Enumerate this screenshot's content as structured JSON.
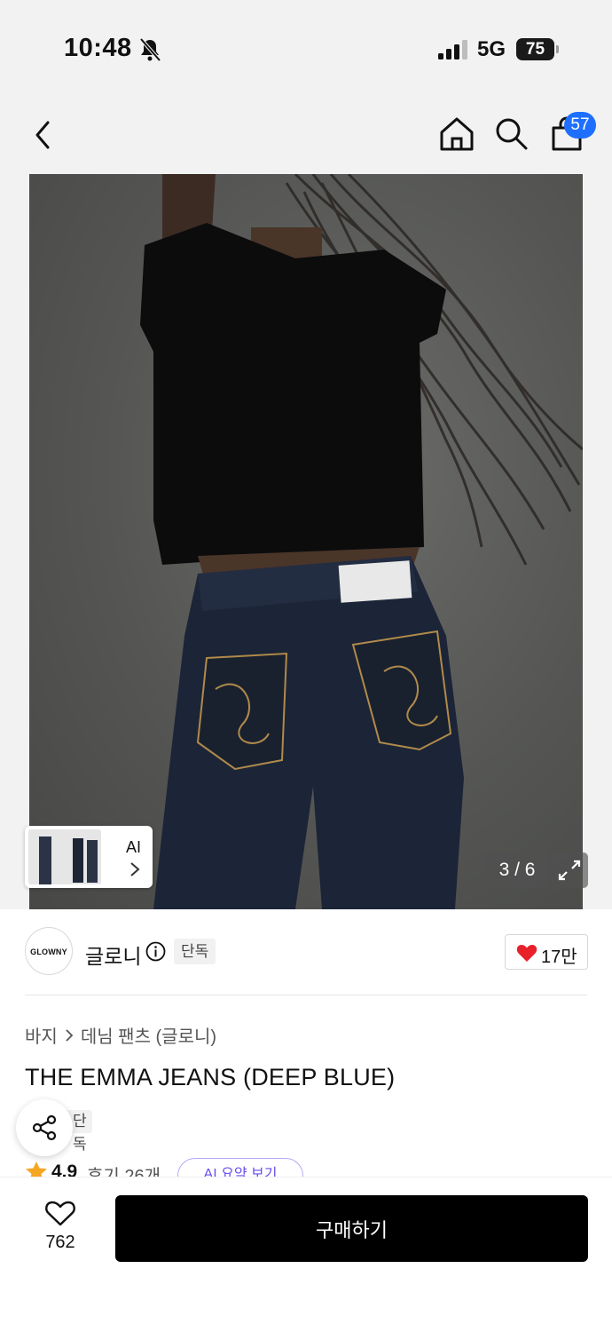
{
  "status_bar": {
    "time": "10:48",
    "network": "5G",
    "battery": "75",
    "icons": [
      "bell-muted-icon",
      "cellular-signal-icon",
      "battery-icon"
    ]
  },
  "header": {
    "cart_count": "57",
    "icons": [
      "back-chevron-icon",
      "home-icon",
      "search-icon",
      "shopping-bag-icon"
    ]
  },
  "gallery": {
    "counter": "3 / 6",
    "ai_label": "AI",
    "icons": [
      "expand-icon",
      "chevron-right-icon"
    ]
  },
  "brand": {
    "logo_text": "GLOWNY",
    "name": "글로니",
    "exclusive_tag": "단독",
    "like_count": "17만"
  },
  "product": {
    "breadcrumb": [
      "바지",
      "데님 팬츠 (글로니)"
    ],
    "title": "THE EMMA JEANS (DEEP BLUE)",
    "exclusive_tag": "단독",
    "rating": "4.9",
    "reviews": "후기 26개",
    "ai_summary": "AI 요약 보기"
  },
  "bottom_bar": {
    "wish_count": "762",
    "buy_label": "구매하기"
  },
  "colors": {
    "accent_badge": "#1f6fff",
    "heart": "#e8202a",
    "star": "#f5a623",
    "buy_button": "#000000"
  }
}
